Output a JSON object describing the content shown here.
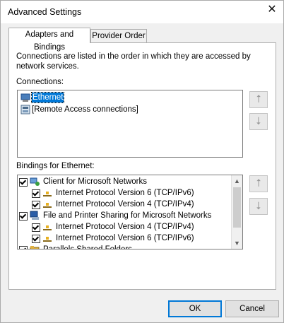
{
  "window": {
    "title": "Advanced Settings",
    "close_glyph": "✕"
  },
  "tabs": [
    {
      "label": "Adapters and Bindings",
      "active": true
    },
    {
      "label": "Provider Order",
      "active": false
    }
  ],
  "description": "Connections are listed in the order in which they are accessed by network services.",
  "connections": {
    "label": "Connections:",
    "items": [
      {
        "label": "Ethernet",
        "icon": "ethernet-adapter-icon",
        "selected": true
      },
      {
        "label": "[Remote Access connections]",
        "icon": "remote-access-icon",
        "selected": false
      }
    ],
    "up_glyph": "⭡",
    "down_glyph": "⭣"
  },
  "bindings": {
    "label": "Bindings for Ethernet:",
    "items": [
      {
        "label": "Client for Microsoft Networks",
        "checked": true,
        "level": 0,
        "icon": "network-client-icon"
      },
      {
        "label": "Internet Protocol Version 6 (TCP/IPv6)",
        "checked": true,
        "level": 1,
        "icon": "protocol-icon"
      },
      {
        "label": "Internet Protocol Version 4 (TCP/IPv4)",
        "checked": true,
        "level": 1,
        "icon": "protocol-icon"
      },
      {
        "label": "File and Printer Sharing for Microsoft Networks",
        "checked": true,
        "level": 0,
        "icon": "file-printer-sharing-icon"
      },
      {
        "label": "Internet Protocol Version 4 (TCP/IPv4)",
        "checked": true,
        "level": 1,
        "icon": "protocol-icon"
      },
      {
        "label": "Internet Protocol Version 6 (TCP/IPv6)",
        "checked": true,
        "level": 1,
        "icon": "protocol-icon"
      },
      {
        "label": "Parallels Shared Folders",
        "checked": true,
        "level": 0,
        "icon": "shared-folders-icon"
      }
    ],
    "up_glyph": "⭡",
    "down_glyph": "⭣"
  },
  "buttons": {
    "ok": "OK",
    "cancel": "Cancel"
  },
  "colors": {
    "selection": "#0078d7",
    "window_bg": "#f0f0f0"
  }
}
